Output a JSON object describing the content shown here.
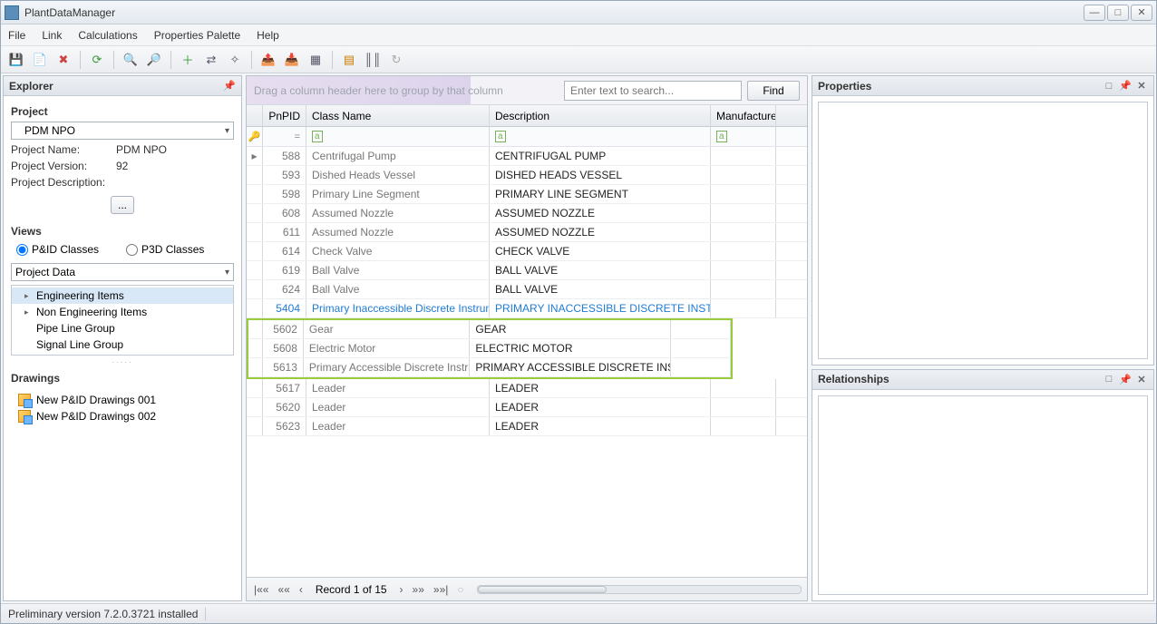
{
  "window": {
    "title": "PlantDataManager"
  },
  "menubar": [
    "File",
    "Link",
    "Calculations",
    "Properties Palette",
    "Help"
  ],
  "explorer": {
    "title": "Explorer",
    "project_label": "Project",
    "project_selected": "PDM NPO",
    "project_name_label": "Project Name:",
    "project_name": "PDM NPO",
    "project_version_label": "Project Version:",
    "project_version": "92",
    "project_desc_label": "Project Description:",
    "ellipsis": "...",
    "views_label": "Views",
    "radio_pid": "P&ID Classes",
    "radio_p3d": "P3D Classes",
    "views_dropdown": "Project Data",
    "tree": [
      {
        "label": "Engineering Items",
        "expandable": true,
        "selected": true
      },
      {
        "label": "Non Engineering Items",
        "expandable": true,
        "selected": false
      },
      {
        "label": "Pipe Line Group",
        "expandable": false,
        "selected": false
      },
      {
        "label": "Signal Line Group",
        "expandable": false,
        "selected": false
      }
    ],
    "drawings_label": "Drawings",
    "drawings": [
      "New P&ID Drawings 001",
      "New P&ID Drawings 002"
    ]
  },
  "grid": {
    "group_hint": "Drag a column header here to group by that column",
    "search_placeholder": "Enter text to search...",
    "find": "Find",
    "columns": [
      "PnPID",
      "Class Name",
      "Description",
      "Manufacturer"
    ],
    "rows": [
      {
        "id": "588",
        "cls": "Centrifugal Pump",
        "desc": "CENTRIFUGAL PUMP",
        "mfr": "",
        "hl": false
      },
      {
        "id": "593",
        "cls": "Dished Heads Vessel",
        "desc": "DISHED HEADS VESSEL",
        "mfr": "",
        "hl": false
      },
      {
        "id": "598",
        "cls": "Primary Line Segment",
        "desc": "PRIMARY LINE SEGMENT",
        "mfr": "",
        "hl": false
      },
      {
        "id": "608",
        "cls": "Assumed Nozzle",
        "desc": "ASSUMED NOZZLE",
        "mfr": "",
        "hl": false
      },
      {
        "id": "611",
        "cls": "Assumed Nozzle",
        "desc": "ASSUMED NOZZLE",
        "mfr": "",
        "hl": false
      },
      {
        "id": "614",
        "cls": "Check Valve",
        "desc": "CHECK VALVE",
        "mfr": "",
        "hl": false
      },
      {
        "id": "619",
        "cls": "Ball Valve",
        "desc": "BALL VALVE",
        "mfr": "",
        "hl": false
      },
      {
        "id": "624",
        "cls": "Ball Valve",
        "desc": "BALL VALVE",
        "mfr": "",
        "hl": false
      },
      {
        "id": "5404",
        "cls": "Primary Inaccessible Discrete Instrument",
        "desc": "PRIMARY INACCESSIBLE DISCRETE INSTRUMENT",
        "mfr": "",
        "hl": true
      },
      {
        "id": "5602",
        "cls": "Gear",
        "desc": "GEAR",
        "mfr": "",
        "hl": false,
        "annot": "start"
      },
      {
        "id": "5608",
        "cls": "Electric Motor",
        "desc": "ELECTRIC MOTOR",
        "mfr": "",
        "hl": false
      },
      {
        "id": "5613",
        "cls": "Primary Accessible Discrete Instrument",
        "desc": "PRIMARY ACCESSIBLE DISCRETE INSTRUMENT",
        "mfr": "",
        "hl": false,
        "annot": "end"
      },
      {
        "id": "5617",
        "cls": "Leader",
        "desc": "LEADER",
        "mfr": "",
        "hl": false
      },
      {
        "id": "5620",
        "cls": "Leader",
        "desc": "LEADER",
        "mfr": "",
        "hl": false
      },
      {
        "id": "5623",
        "cls": "Leader",
        "desc": "LEADER",
        "mfr": "",
        "hl": false
      }
    ],
    "record_text": "Record 1 of 15"
  },
  "properties": {
    "title": "Properties"
  },
  "relationships": {
    "title": "Relationships"
  },
  "status": "Preliminary version 7.2.0.3721 installed"
}
